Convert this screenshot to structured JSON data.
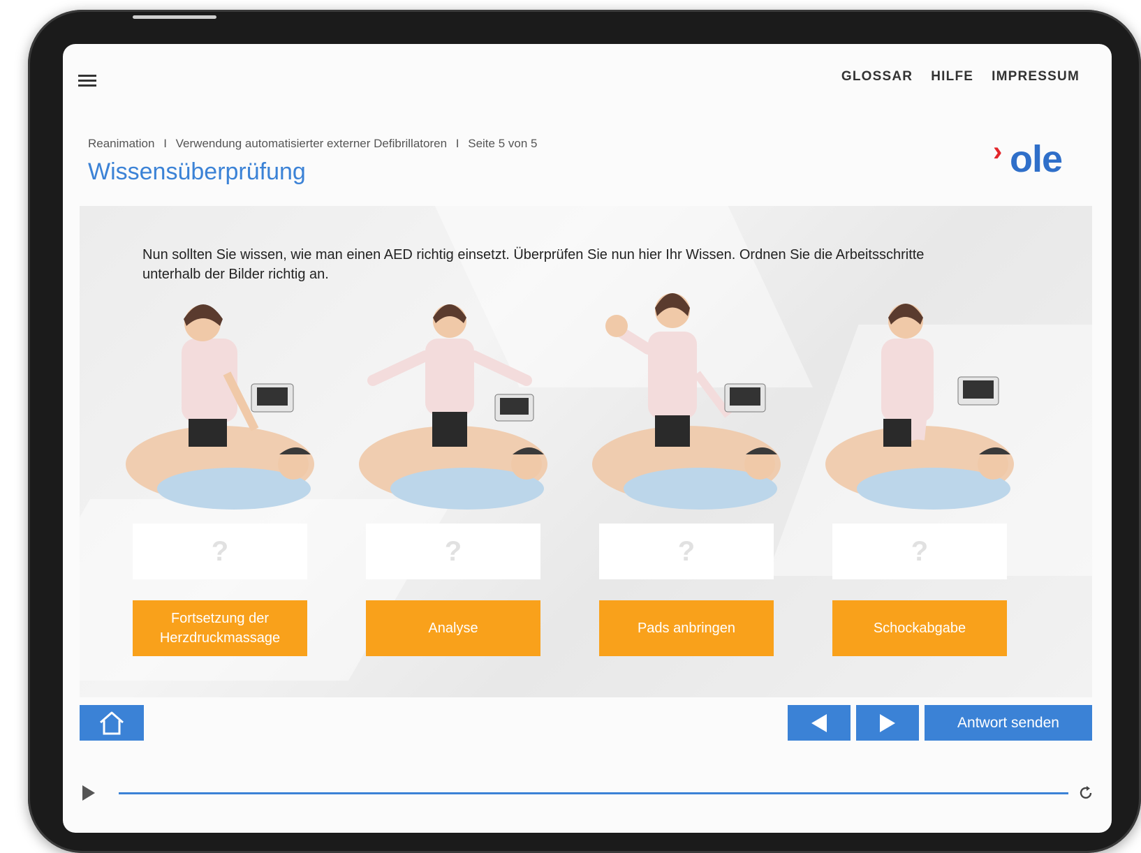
{
  "nav": {
    "links": [
      "GLOSSAR",
      "HILFE",
      "IMPRESSUM"
    ]
  },
  "breadcrumb": {
    "items": [
      "Reanimation",
      "Verwendung automatisierter externer Defibrillatoren",
      "Seite 5 von 5"
    ],
    "separator": "I"
  },
  "page_title": "Wissensüberprüfung",
  "logo": {
    "chevron": "›",
    "text": "ole"
  },
  "intro": "Nun sollten Sie wissen, wie man einen AED richtig einsetzt. Überprüfen Sie nun hier Ihr Wissen. Ordnen Sie die Arbeitsschritte unterhalb der Bilder richtig an.",
  "steps": [
    {
      "image": "person-applying-pads-illustration",
      "placeholder": "?",
      "chip": "Fortsetzung der Herzdruckmassage"
    },
    {
      "image": "person-arms-out-analysis-illustration",
      "placeholder": "?",
      "chip": "Analyse"
    },
    {
      "image": "person-stop-hand-shock-illustration",
      "placeholder": "?",
      "chip": "Pads anbringen"
    },
    {
      "image": "person-chest-compression-illustration",
      "placeholder": "?",
      "chip": "Schockabgabe"
    }
  ],
  "buttons": {
    "send": "Antwort senden"
  },
  "player": {
    "progress": 1.0
  },
  "colors": {
    "accent": "#3b82d6",
    "chip": "#f9a11b",
    "logo_red": "#e3262b",
    "logo_blue": "#2f6fc9"
  }
}
